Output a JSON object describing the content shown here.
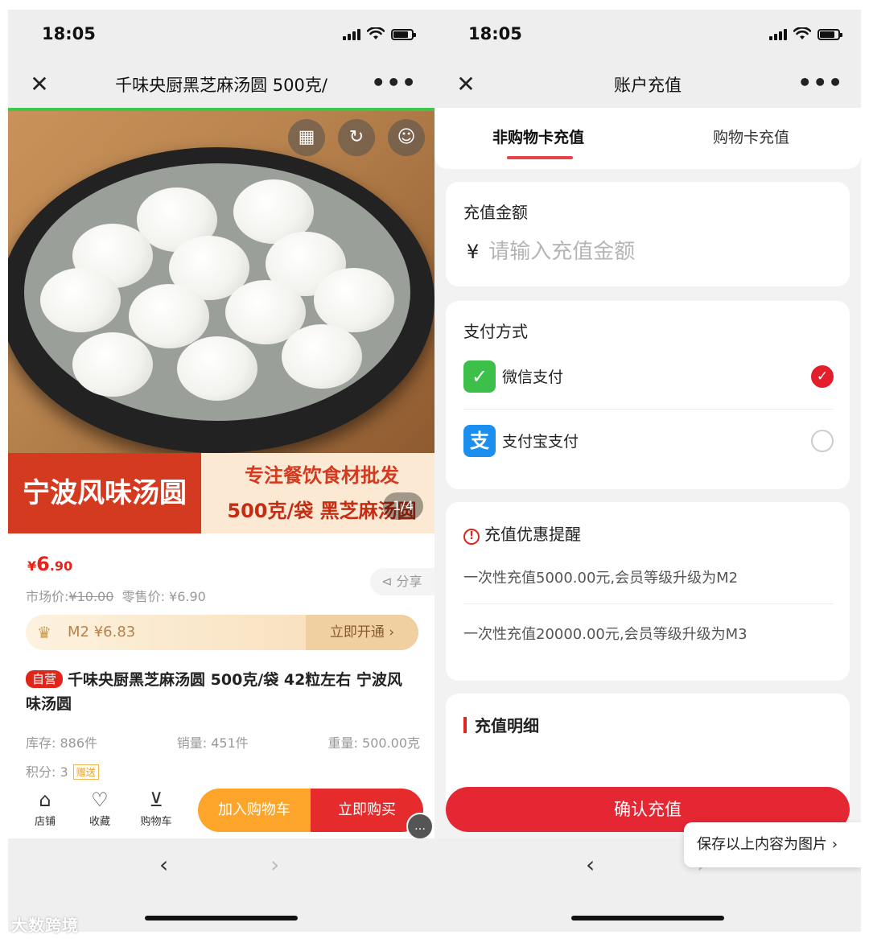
{
  "left": {
    "status": {
      "time": "18:05"
    },
    "nav": {
      "close": "✕",
      "title": "千味央厨黑芝麻汤圆 500克/",
      "more": "•••"
    },
    "hero_icons": {
      "qr": "qr-code-icon",
      "share": "share-icon",
      "user": "user-icon"
    },
    "banner": {
      "left": "宁波风味汤圆",
      "right_line1": "专注餐饮食材批发",
      "right_line2": "500克/袋  黑芝麻汤圆"
    },
    "pager": "1/4",
    "price": {
      "symbol": "¥",
      "integer": "6",
      "decimal": ".90"
    },
    "market": {
      "market_label": "市场价:",
      "market_price": "¥10.00",
      "retail": "零售价: ¥6.90"
    },
    "share_label": "分享",
    "member": {
      "level": "M2 ¥6.83",
      "open": "立即开通 ›"
    },
    "product": {
      "tag": "自营",
      "title": "千味央厨黑芝麻汤圆 500克/袋 42粒左右 宁波风味汤圆"
    },
    "stats": {
      "stock": "库存: 886件",
      "sales": "销量: 451件",
      "weight": "重量: 500.00克"
    },
    "points": {
      "label": "积分: 3",
      "gift": "赠送"
    },
    "actions": {
      "store": "店铺",
      "fav": "收藏",
      "cart": "购物车",
      "add_cart": "加入购物车",
      "buy_now": "立即购买"
    },
    "bottom": {
      "back": "‹",
      "forward": "›"
    }
  },
  "right": {
    "status": {
      "time": "18:05"
    },
    "nav": {
      "close": "✕",
      "title": "账户充值",
      "more": "•••"
    },
    "tabs": {
      "non_card": "非购物卡充值",
      "card": "购物卡充值"
    },
    "amount": {
      "label": "充值金额",
      "currency": "¥",
      "placeholder": "请输入充值金额"
    },
    "payment": {
      "label": "支付方式",
      "wechat": "微信支付",
      "alipay": "支付宝支付",
      "check": "✓"
    },
    "promo": {
      "icon": "!",
      "title": "充值优惠提醒",
      "tip1": "一次性充值5000.00元,会员等级升级为M2",
      "tip2": "一次性充值20000.00元,会员等级升级为M3"
    },
    "detail": {
      "title": "充值明细"
    },
    "confirm": "确认充值",
    "save_image": "保存以上内容为图片 ›",
    "bottom": {
      "back": "‹",
      "forward": "›"
    }
  },
  "watermark": "大数跨境",
  "colors": {
    "accent_red": "#e52733",
    "orange": "#fca52a",
    "green_progress": "#3ec64a",
    "wechat_green": "#3cc04a",
    "alipay_blue": "#1b8ff0"
  }
}
